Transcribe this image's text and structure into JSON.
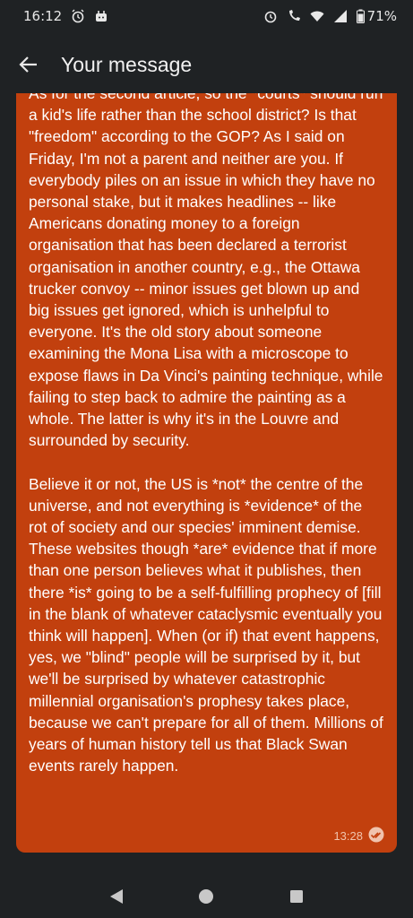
{
  "status_bar": {
    "time": "16:12",
    "battery": "71%",
    "icons": [
      "alarm-icon",
      "notification-app-icon",
      "alarm-icon",
      "call-wifi-icon",
      "wifi-icon",
      "signal-icon",
      "battery-icon"
    ]
  },
  "app_bar": {
    "title": "Your message",
    "back_icon": "arrow-left-icon"
  },
  "message": {
    "text": "As for the second article, so the *courts* should run a kid's life rather than the school district? Is that \"freedom\" according to the GOP? As I said on Friday, I'm not a parent and neither are you. If everybody piles on an issue in which they have no personal stake, but it makes headlines -- like Americans donating money to a foreign organisation that has been declared a terrorist organisation in another country, e.g., the Ottawa trucker convoy -- minor issues get blown up and big issues get ignored, which is unhelpful to everyone. It's the old story about someone examining the Mona Lisa with a microscope to expose flaws in Da Vinci's painting technique, while failing to step back to admire the painting as a whole. The latter is why it's in the Louvre and surrounded by security.\n\nBelieve it or not, the US is *not* the centre of the universe, and not everything is *evidence* of the rot of society and our species' imminent demise. These websites though *are* evidence that if more than one person believes what it publishes, then there *is* going to be a self-fulfilling prophecy of [fill in the blank of whatever cataclysmic eventually you think will happen]. When (or if) that event happens, yes, we \"blind\" people will be surprised by it, but we'll be surprised by whatever catastrophic millennial organisation's prophesy takes place, because we can't prepare for all of them. Millions of years of human history tell us that Black Swan events rarely happen.",
    "time": "13:28",
    "status_icon": "double-check-icon",
    "bubble_color": "#c2400e"
  },
  "nav_bar": {
    "buttons": [
      "back-triangle-icon",
      "home-circle-icon",
      "recents-square-icon"
    ]
  }
}
